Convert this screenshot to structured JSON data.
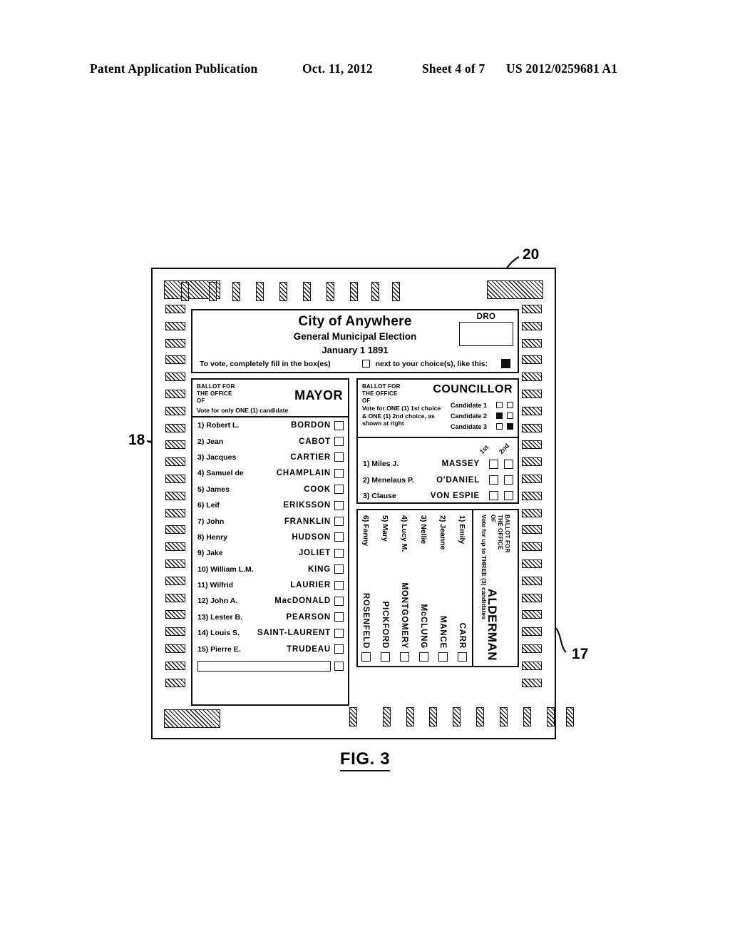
{
  "header": {
    "title": "Patent Application Publication",
    "date": "Oct. 11, 2012",
    "sheet": "Sheet 4 of 7",
    "number": "US 2012/0259681 A1"
  },
  "figure": {
    "label": "FIG. 3",
    "refs": {
      "dro": "20",
      "candidate_rows": "18",
      "ballot_sheet": "17"
    }
  },
  "ballot": {
    "city": "City of Anywhere",
    "election": "General Municipal Election",
    "date": "January 1 1891",
    "instruction_part1": "To vote, completely fill in the box(es)",
    "instruction_part2": "next to your choice(s), like this:",
    "dro_label": "DRO"
  },
  "races": {
    "mayor": {
      "ballot_for": "BALLOT FOR\nTHE OFFICE\nOF",
      "office": "MAYOR",
      "rule": "Vote for only ONE (1) candidate",
      "candidates": [
        {
          "num": "1)",
          "first": "Robert L.",
          "last": "BORDON"
        },
        {
          "num": "2)",
          "first": "Jean",
          "last": "CABOT"
        },
        {
          "num": "3)",
          "first": "Jacques",
          "last": "CARTIER"
        },
        {
          "num": "4)",
          "first": "Samuel de",
          "last": "CHAMPLAIN"
        },
        {
          "num": "5)",
          "first": "James",
          "last": "COOK"
        },
        {
          "num": "6)",
          "first": "Leif",
          "last": "ERIKSSON"
        },
        {
          "num": "7)",
          "first": "John",
          "last": "FRANKLIN"
        },
        {
          "num": "8)",
          "first": "Henry",
          "last": "HUDSON"
        },
        {
          "num": "9)",
          "first": "Jake",
          "last": "JOLIET"
        },
        {
          "num": "10)",
          "first": "William L.M.",
          "last": "KING"
        },
        {
          "num": "11)",
          "first": "Wilfrid",
          "last": "LAURIER"
        },
        {
          "num": "12)",
          "first": "John A.",
          "last": "MacDONALD"
        },
        {
          "num": "13)",
          "first": "Lester B.",
          "last": "PEARSON"
        },
        {
          "num": "14)",
          "first": "Louis S.",
          "last": "SAINT-LAURENT"
        },
        {
          "num": "15)",
          "first": "Pierre E.",
          "last": "TRUDEAU"
        }
      ],
      "has_write_in": true
    },
    "councillor": {
      "ballot_for": "BALLOT FOR\nTHE OFFICE\nOF",
      "office": "COUNCILLOR",
      "rule": "Vote for ONE (1) 1st choice\n& ONE (1) 2nd choice, as\nshown at right",
      "sample_key": [
        {
          "label": "Candidate 1",
          "first_filled": false,
          "second_filled": false
        },
        {
          "label": "Candidate 2",
          "first_filled": true,
          "second_filled": false
        },
        {
          "label": "Candidate 3",
          "first_filled": false,
          "second_filled": true
        }
      ],
      "rank_labels": {
        "first": "1st",
        "second": "2nd"
      },
      "candidates": [
        {
          "num": "1)",
          "first": "Miles J.",
          "last": "MASSEY"
        },
        {
          "num": "2)",
          "first": "Menelaus P.",
          "last": "O'DANIEL"
        },
        {
          "num": "3)",
          "first": "Clause",
          "last": "VON ESPIE"
        }
      ]
    },
    "alderman": {
      "ballot_for": "BALLOT FOR\nTHE OFFICE\nOF",
      "office": "ALDERMAN",
      "rule": "Vote for up to THREE (3) candidates",
      "candidates": [
        {
          "num": "1)",
          "first": "Emily",
          "last": "CARR"
        },
        {
          "num": "2)",
          "first": "Jeanne",
          "last": "MANCE"
        },
        {
          "num": "3)",
          "first": "Nellie",
          "last": "McCLUNG"
        },
        {
          "num": "4)",
          "first": "Lucy M.",
          "last": "MONTGOMERY"
        },
        {
          "num": "5)",
          "first": "Mary",
          "last": "PICKFORD"
        },
        {
          "num": "6)",
          "first": "Fanny",
          "last": "ROSENFELD"
        }
      ]
    }
  },
  "timing_marks": {
    "left_count": 23,
    "right_count": 23,
    "top_count": 10,
    "bottom_count": 10
  },
  "colors": {
    "ink": "#111111",
    "paper": "#ffffff"
  }
}
